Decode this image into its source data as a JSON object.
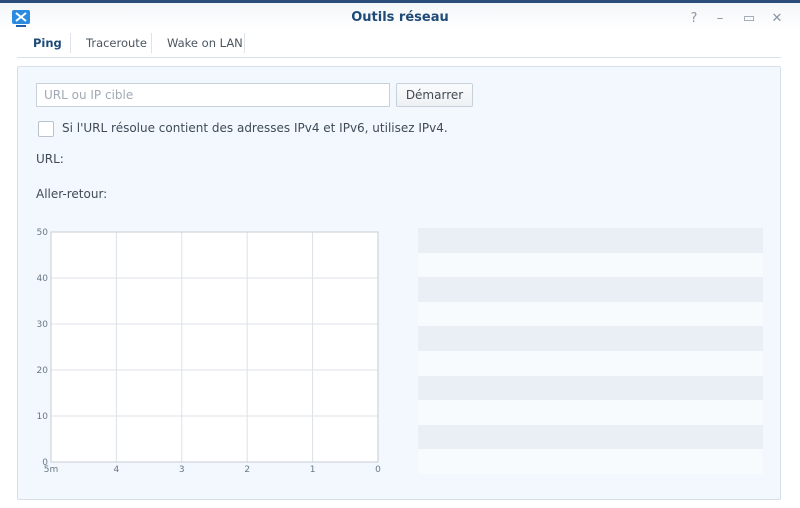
{
  "window": {
    "title": "Outils réseau",
    "controls": [
      "?",
      "–",
      "▭",
      "✕"
    ]
  },
  "tabs": [
    {
      "label": "Ping"
    },
    {
      "label": "Traceroute"
    },
    {
      "label": "Wake on LAN"
    }
  ],
  "ping": {
    "target_placeholder": "URL ou IP cible",
    "target_value": "",
    "start_label": "Démarrer",
    "ipv4_checkbox_label": "Si l'URL résolue contient des adresses IPv4 et IPv6, utilisez IPv4.",
    "ipv4_checked": false,
    "url_label": "URL:",
    "rtt_label": "Aller-retour:"
  },
  "chart_data": {
    "type": "line",
    "title": "",
    "xlabel": "",
    "ylabel": "",
    "x_ticks": [
      "5m",
      "4",
      "3",
      "2",
      "1",
      "0"
    ],
    "y_ticks": [
      0,
      10,
      20,
      30,
      40,
      50
    ],
    "ylim": [
      0,
      50
    ],
    "grid": true,
    "series": []
  },
  "results_table": {
    "rows": 10
  }
}
